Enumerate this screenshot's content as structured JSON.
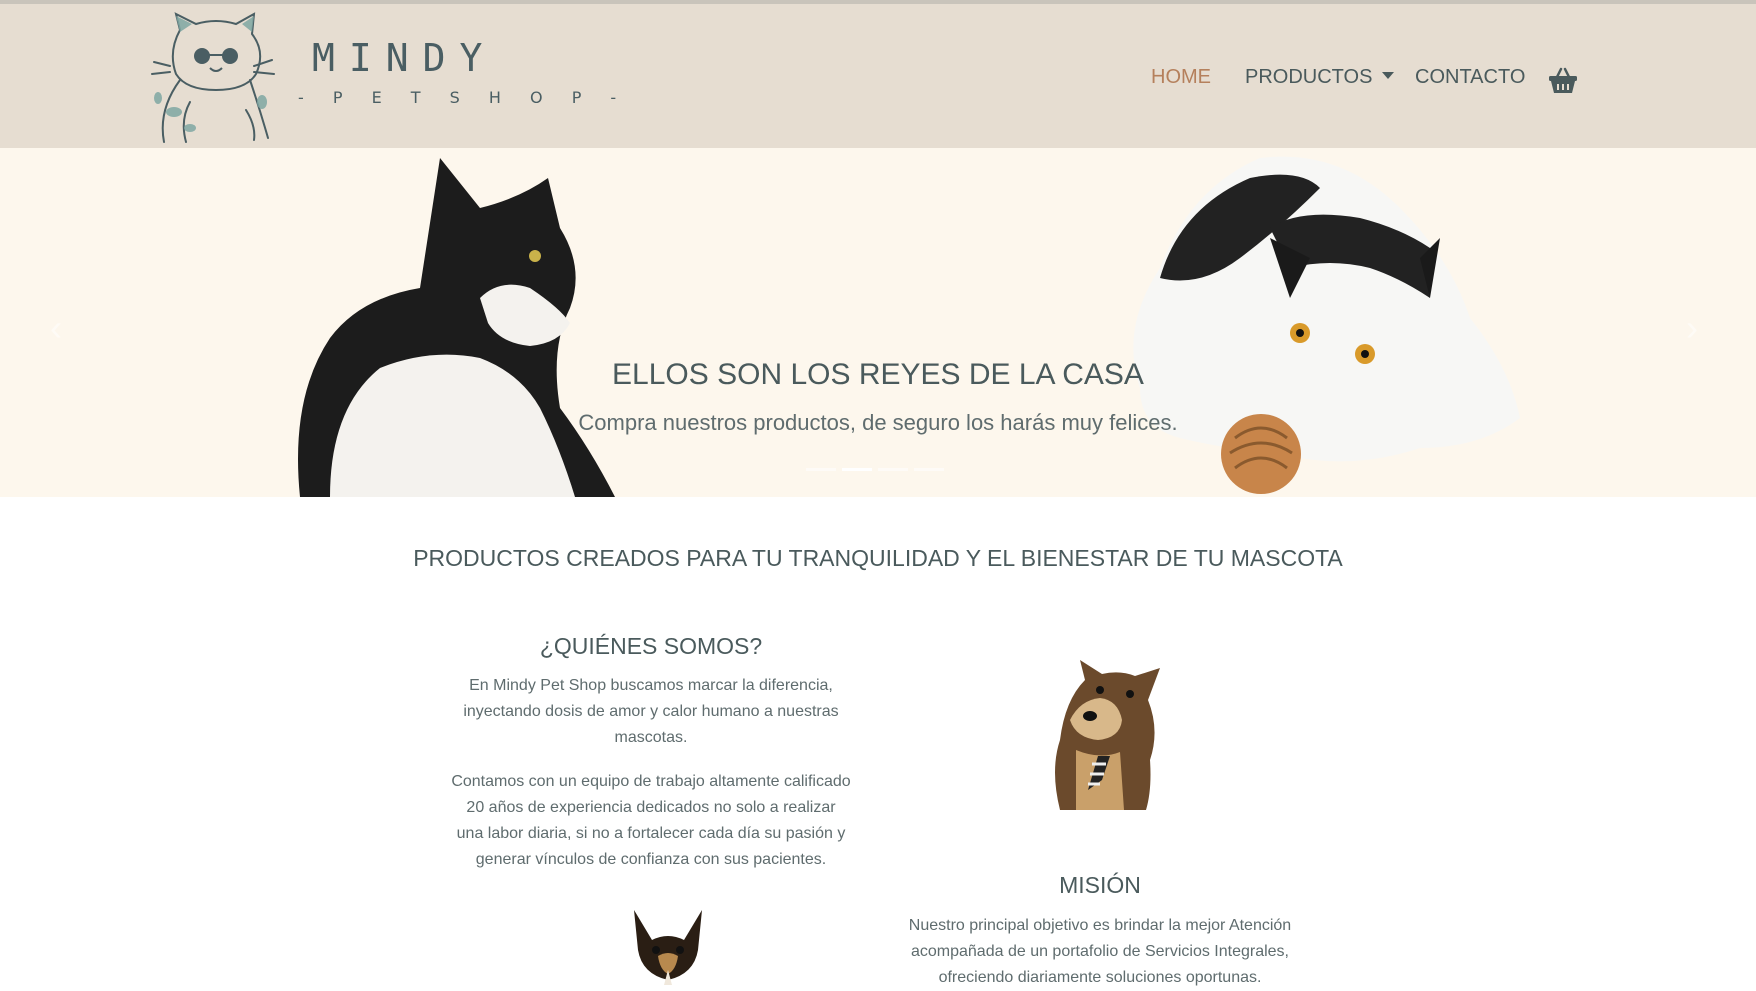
{
  "brand": {
    "name": "MINDY",
    "subtitle": "- P E T  S H O P -"
  },
  "nav": {
    "home": "HOME",
    "products": "PRODUCTOS",
    "contact": "CONTACTO",
    "cart_icon": "basket-icon"
  },
  "hero": {
    "title": "ELLOS SON LOS REYES DE LA CASA",
    "subtitle": "Compra nuestros productos, de seguro los harás muy felices.",
    "slide_count": 4,
    "active_slide": 2
  },
  "main": {
    "section_title": "PRODUCTOS CREADOS PARA TU TRANQUILIDAD Y EL BIENESTAR DE TU MASCOTA",
    "about": {
      "title": "¿QUIÉNES SOMOS?",
      "p1": "En Mindy Pet Shop buscamos marcar la diferencia, inyectando dosis de amor y calor humano a nuestras mascotas.",
      "p2": "Contamos con un equipo de trabajo altamente calificado 20 años de experiencia dedicados no solo a realizar una labor diaria, si no a fortalecer cada día su pasión y generar vínculos de confianza con sus pacientes."
    },
    "mission": {
      "title": "MISIÓN",
      "p1": "Nuestro principal objetivo es brindar la mejor Atención acompañada de un portafolio de Servicios Integrales, ofreciendo diariamente soluciones oportunas."
    }
  },
  "colors": {
    "navbar_bg": "#e6ddd1",
    "hero_bg": "#fdf7ed",
    "active_link": "#b5805c",
    "text": "#4a5a5c",
    "logo_accent": "#7fa7a3"
  }
}
